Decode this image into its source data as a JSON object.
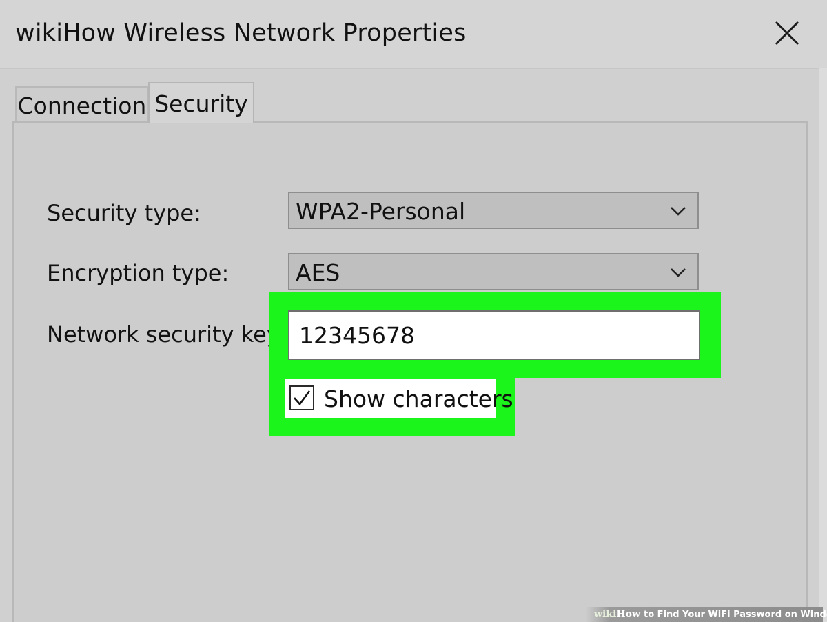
{
  "window": {
    "title": "wikiHow Wireless Network Properties",
    "close_icon": "close-icon"
  },
  "tabs": [
    {
      "label": "Connection",
      "active": false
    },
    {
      "label": "Security",
      "active": true
    }
  ],
  "form": {
    "security_type_label": "Security type:",
    "security_type_value": "WPA2-Personal",
    "encryption_type_label": "Encryption type:",
    "encryption_type_value": "AES",
    "network_key_label": "Network security key",
    "network_key_value": "12345678",
    "show_characters_label": "Show characters",
    "show_characters_checked": true
  },
  "highlight": {
    "color": "#1cf51c"
  },
  "watermark": {
    "wiki": "wiki",
    "how": "How",
    "text": "to Find Your WiFi Password on Windows"
  }
}
